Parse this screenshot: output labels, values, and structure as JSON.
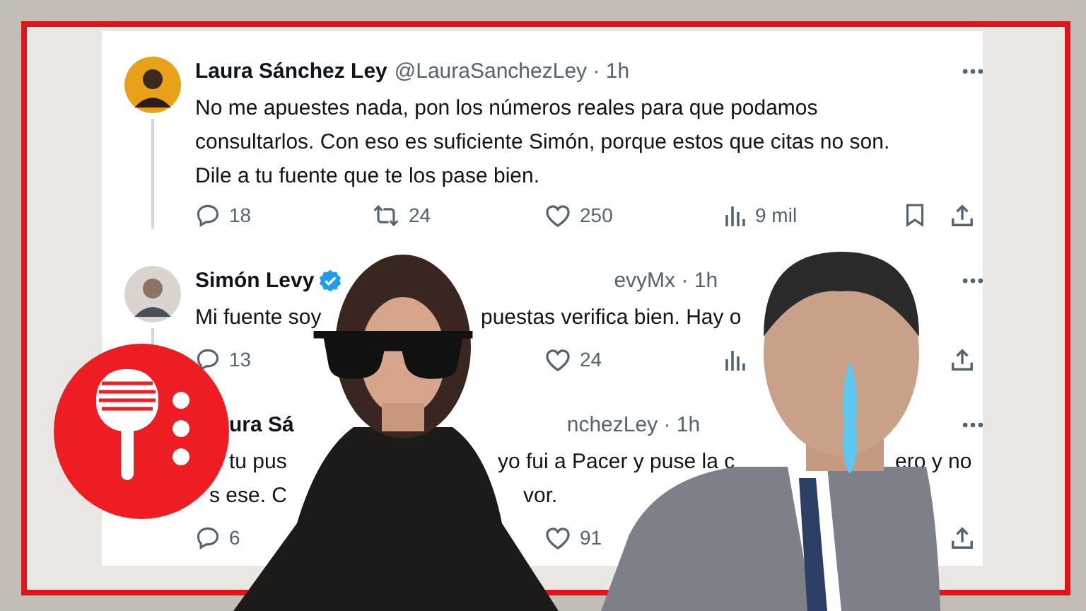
{
  "tweets": [
    {
      "author": "Laura Sánchez Ley",
      "verified": false,
      "meta": "@LauraSanchezLey · 1h",
      "body": [
        [
          "No me apuestes nada, pon los números reales para que podamos"
        ],
        [
          "consultarlos. Con eso es suficiente Simón, porque estos que citas no son."
        ],
        [
          "Dile a tu fuente que te los pase bien."
        ]
      ],
      "actions": [
        {
          "kind": "reply",
          "count": "18"
        },
        {
          "kind": "repost",
          "count": "24"
        },
        {
          "kind": "like",
          "count": "250"
        },
        {
          "kind": "views",
          "count": "9 mil"
        },
        {
          "kind": "bookmark"
        },
        {
          "kind": "share"
        }
      ]
    },
    {
      "author": "Simón Levy",
      "verified": true,
      "meta": "evyMx · 1h",
      "body": [
        [
          "Mi fuente soy",
          "puestas verifica bien. Hay o"
        ]
      ],
      "actions": [
        {
          "kind": "reply",
          "count": "13"
        },
        {
          "kind": "like",
          "count": "24"
        },
        {
          "kind": "views"
        },
        {
          "kind": "share"
        }
      ]
    },
    {
      "author": "ura Sá",
      "verified": false,
      "meta": "nchezLey · 1h",
      "body": [
        [
          "tu pus",
          "yo fui a Pacer y puse la c",
          "ero y no"
        ],
        [
          "s ese. C",
          "vor."
        ]
      ],
      "actions": [
        {
          "kind": "reply",
          "count": "6"
        },
        {
          "kind": "like",
          "count": "91"
        },
        {
          "kind": "share"
        }
      ]
    }
  ]
}
